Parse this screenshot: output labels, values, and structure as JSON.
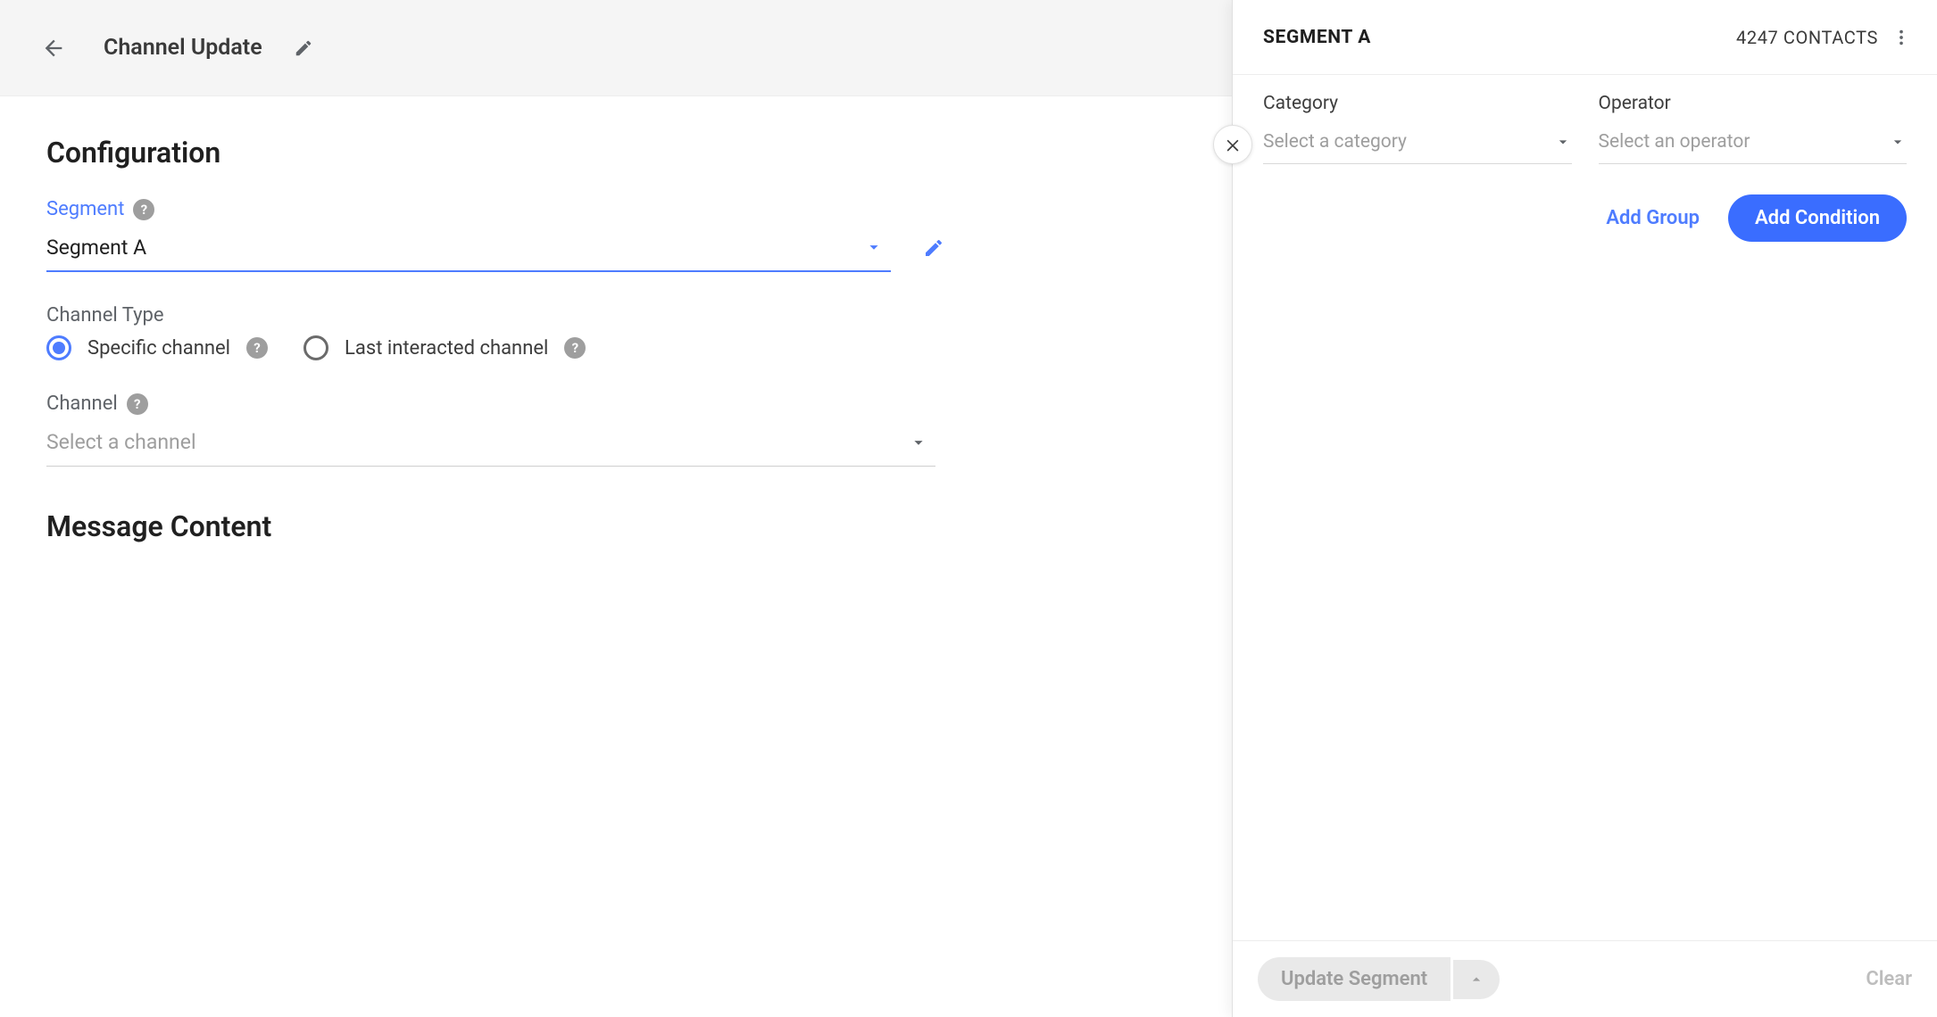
{
  "app_bar": {
    "title": "Channel Update"
  },
  "config": {
    "heading": "Configuration",
    "segment": {
      "label": "Segment",
      "value": "Segment A"
    },
    "channel_type": {
      "label": "Channel Type",
      "options": [
        {
          "label": "Specific channel",
          "checked": true
        },
        {
          "label": "Last interacted channel",
          "checked": false
        }
      ]
    },
    "channel": {
      "label": "Channel",
      "placeholder": "Select a channel"
    },
    "message_heading": "Message Content"
  },
  "side": {
    "title": "SEGMENT A",
    "contacts": "4247 CONTACTS",
    "condition": {
      "category_label": "Category",
      "category_placeholder": "Select a category",
      "operator_label": "Operator",
      "operator_placeholder": "Select an operator"
    },
    "actions": {
      "add_group": "Add Group",
      "add_condition": "Add Condition"
    },
    "footer": {
      "update": "Update Segment",
      "clear": "Clear"
    }
  }
}
